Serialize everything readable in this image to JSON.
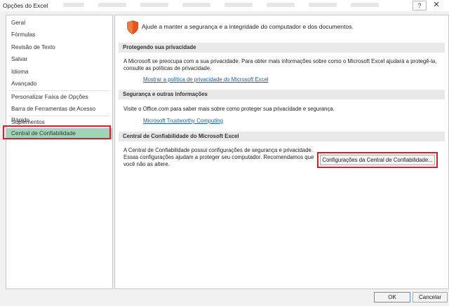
{
  "window": {
    "title": "Opções do Excel",
    "help_label": "?",
    "close_label": "✕"
  },
  "sidebar": {
    "items": [
      {
        "label": "Geral"
      },
      {
        "label": "Fórmulas"
      },
      {
        "label": "Revisão de Texto"
      },
      {
        "label": "Salvar"
      },
      {
        "label": "Idioma"
      },
      {
        "label": "Avançado"
      },
      {
        "label": "Personalizar Faixa de Opções"
      },
      {
        "label": "Barra de Ferramentas de Acesso Rápido"
      },
      {
        "label": "Suplementos"
      },
      {
        "label": "Central de Confiabilidade"
      }
    ],
    "selected_color": "#9fd5b7",
    "highlight_color": "#e31b23"
  },
  "main": {
    "header": "Ajude a manter a segurança e a integridade do computador e dos documentos.",
    "privacy": {
      "title": "Protegendo sua privacidade",
      "text_line1": "A Microsoft se preocupa com a sua privacidade. Para obter mais informações sobre como o Microsoft Excel ajudará a protegê-la,",
      "text_line2": "consulte as políticas de privacidade.",
      "link": "Mostrar a política de privacidade do Microsoft Excel"
    },
    "security": {
      "title": "Segurança e outras informações",
      "text": "Visite o Office.com para saber mais sobre como proteger sua privacidade e segurança.",
      "link": "Microsoft Trustworthy Computing"
    },
    "trust_center": {
      "title": "Central de Confiabilidade do Microsoft Excel",
      "text_line1": "A Central de Confiabilidade possui configurações de segurança e privacidade.",
      "text_line2": "Essas configurações ajudam a proteger seu computador. Recomendamos que",
      "text_line3": "você não as altere.",
      "button": "Configurações da Central de Confiabilidade..."
    },
    "shield_color": "#e8541e"
  },
  "footer": {
    "ok": "OK",
    "cancel": "Cancelar"
  }
}
